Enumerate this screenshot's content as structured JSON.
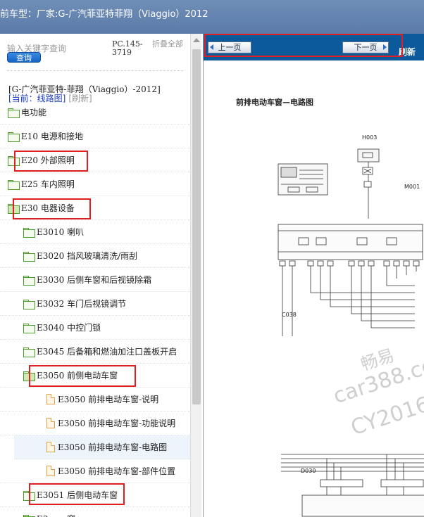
{
  "window": {
    "title": "前车型：厂家:G-广汽菲亚特菲翔（Viaggio）2012"
  },
  "search": {
    "placeholder": "输入关键字查询",
    "button_label": "查询",
    "pc_code": "PC.145-3719",
    "collapse_all_label": "折叠全部"
  },
  "context": {
    "car_line": "[G-广汽菲亚特-菲翔（Viaggio）-2012]",
    "current_label": "[当前：线路图]",
    "refresh_label": "[刷新]"
  },
  "tree": [
    {
      "label": "电功能",
      "type": "folder",
      "open": false
    },
    {
      "label": "E10 电源和接地",
      "type": "folder",
      "open": false
    },
    {
      "label": "E20 外部照明",
      "type": "folder",
      "open": false
    },
    {
      "label": "E25 车内照明",
      "type": "folder",
      "open": false
    },
    {
      "label": "E30 电器设备",
      "type": "folder",
      "open": true
    },
    {
      "label": "E3010 喇叭",
      "type": "folder",
      "open": false
    },
    {
      "label": "E3020 挡风玻璃清洗/雨刮",
      "type": "folder",
      "open": false
    },
    {
      "label": "E3030 后侧车窗和后视镜除霜",
      "type": "folder",
      "open": false
    },
    {
      "label": "E3032 车门后视镜调节",
      "type": "folder",
      "open": false
    },
    {
      "label": "E3040 中控门锁",
      "type": "folder",
      "open": false
    },
    {
      "label": "E3045 后备箱和燃油加注口盖板开启",
      "type": "folder",
      "open": false
    },
    {
      "label": "E3050 前侧电动车窗",
      "type": "folder",
      "open": true
    },
    {
      "label": "E3050 前排电动车窗-说明",
      "type": "doc"
    },
    {
      "label": "E3050 前排电动车窗-功能说明",
      "type": "doc"
    },
    {
      "label": "E3050 前排电动车窗-电路图",
      "type": "doc",
      "selected": true
    },
    {
      "label": "E3050 前排电动车窗-部件位置",
      "type": "doc"
    },
    {
      "label": "E3051 后侧电动车窗",
      "type": "folder",
      "open": false
    },
    {
      "label": "E3... ...窗",
      "type": "folder",
      "open": false
    }
  ],
  "viewer": {
    "prev_label": "上一页",
    "next_label": "下一页",
    "refresh_partial": "刷新",
    "diagram_title": "前排电动车窗—电路图",
    "components": {
      "h003": "H003",
      "m001": "M001",
      "c038": "C038",
      "d030": "D030"
    },
    "watermark": {
      "line1": "畅易",
      "line2": "car388.co",
      "line3": "CY2016"
    }
  },
  "colors": {
    "title_bar": "#5b7aa8",
    "nav_bar": "#0c5a9b",
    "highlight": "#e02020",
    "search_button": "#1463c7",
    "folder_green": "#4e9a2c",
    "doc_orange": "#e0a34a"
  }
}
